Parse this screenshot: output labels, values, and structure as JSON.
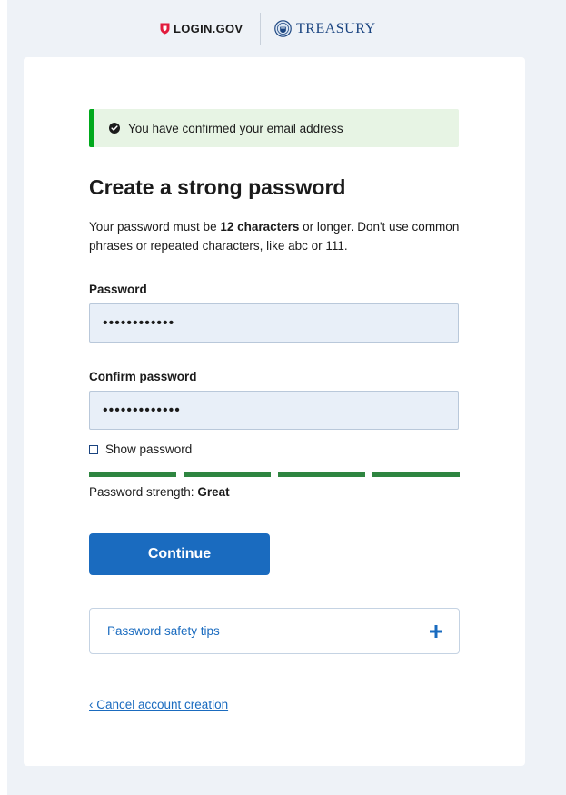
{
  "header": {
    "login_brand": "LOGIN.GOV",
    "partner_brand": "TREASURY"
  },
  "alert": {
    "message": "You have confirmed your email address"
  },
  "page": {
    "title": "Create a strong password",
    "intro_prefix": "Your password must be ",
    "intro_bold": "12 characters",
    "intro_suffix": " or longer. Don't use common phrases or repeated characters, like abc or 111."
  },
  "form": {
    "password_label": "Password",
    "password_value": "••••••••••••",
    "confirm_label": "Confirm password",
    "confirm_value": "•••••••••••••",
    "show_password_label": "Show password",
    "show_password_checked": false
  },
  "strength": {
    "bars_filled": 4,
    "bars_total": 4,
    "label": "Password strength: ",
    "value": "Great",
    "color": "#2e8540"
  },
  "actions": {
    "continue_label": "Continue",
    "tips_label": "Password safety tips",
    "cancel_label": "‹ Cancel account creation"
  },
  "colors": {
    "primary": "#1a6bbf",
    "success": "#00a91c",
    "alert_bg": "#e7f4e4",
    "brand_red": "#e21c3d",
    "page_bg": "#eef2f7"
  },
  "icons": {
    "login_logo": "shield-icon",
    "partner_logo": "seal-icon",
    "alert": "check-circle-icon",
    "accordion": "plus-icon"
  }
}
